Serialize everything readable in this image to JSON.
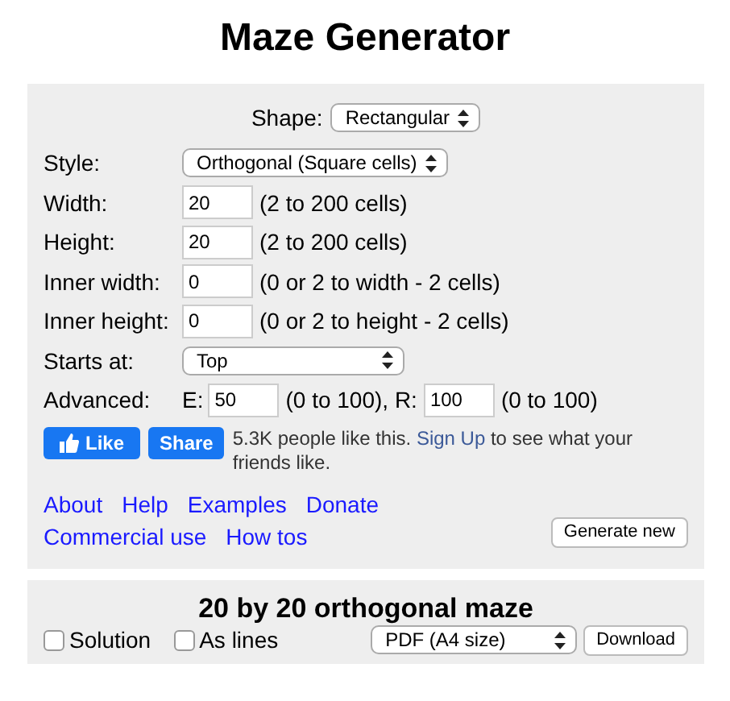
{
  "title": "Maze Generator",
  "generator": {
    "shape": {
      "label": "Shape:",
      "value": "Rectangular"
    },
    "rows": [
      {
        "kind": "select",
        "label": "Style:",
        "value": "Orthogonal (Square cells)",
        "wide": false
      },
      {
        "kind": "input",
        "label": "Width:",
        "value": "20",
        "hint": "(2 to 200 cells)"
      },
      {
        "kind": "input",
        "label": "Height:",
        "value": "20",
        "hint": "(2 to 200 cells)"
      },
      {
        "kind": "input",
        "label": "Inner width:",
        "value": "0",
        "hint": "(0 or 2 to width - 2 cells)"
      },
      {
        "kind": "input",
        "label": "Inner height:",
        "value": "0",
        "hint": "(0 or 2 to height - 2 cells)"
      },
      {
        "kind": "select",
        "label": "Starts at:",
        "value": "Top",
        "wide": true
      }
    ],
    "advanced": {
      "label": "Advanced:",
      "e_label": "E:",
      "e_value": "50",
      "e_hint": "(0 to 100), R:",
      "r_value": "100",
      "r_hint": "(0 to 100)"
    },
    "social": {
      "like": "Like",
      "share": "Share",
      "text": "5.3K people like this.",
      "link": "Sign Up",
      "text_after": "to see what your friends like."
    },
    "links": [
      [
        "About",
        "Help",
        "Examples",
        "Donate"
      ],
      [
        "Commercial use",
        "How tos"
      ]
    ],
    "generate_button": "Generate new"
  },
  "result": {
    "title": "20 by 20 orthogonal maze",
    "options": [
      {
        "label": "Solution",
        "checked": false
      },
      {
        "label": "As lines",
        "checked": false
      }
    ],
    "format": "PDF (A4 size)",
    "download_button": "Download"
  }
}
